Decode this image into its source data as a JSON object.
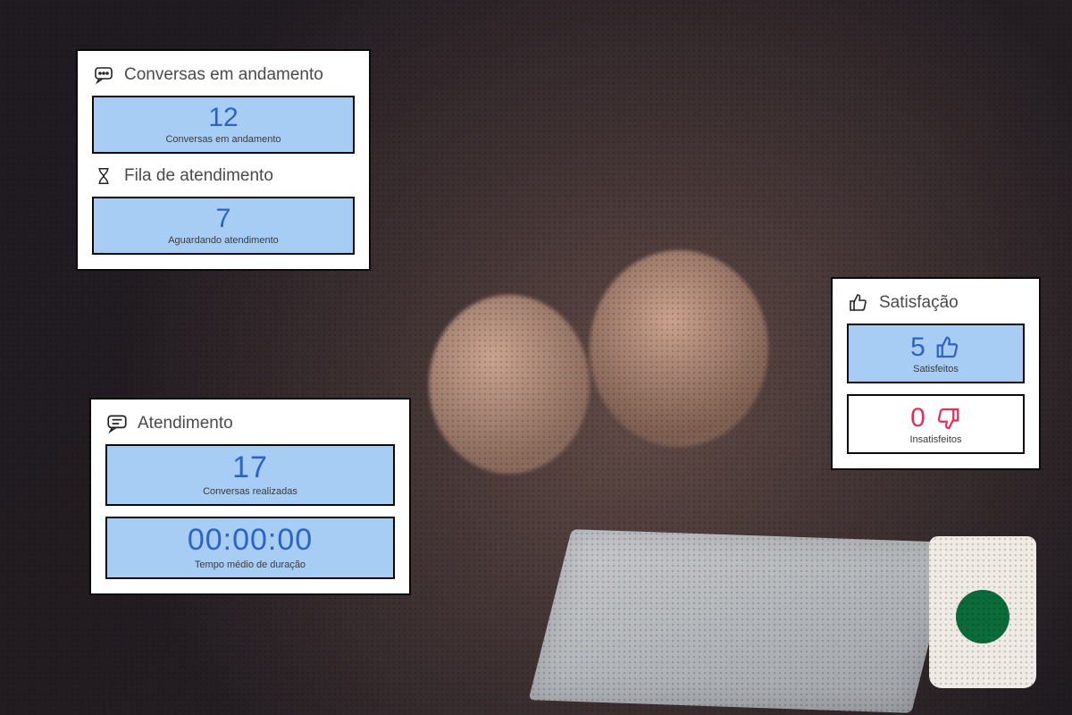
{
  "colors": {
    "accent_blue": "#2b64c4",
    "accent_red": "#e0315a",
    "panel_blue": "#a8cdf4"
  },
  "cards": {
    "conversas": {
      "title": "Conversas em andamento",
      "metric1": {
        "value": "12",
        "label": "Conversas em andamento"
      },
      "title2": "Fila de atendimento",
      "metric2": {
        "value": "7",
        "label": "Aguardando atendimento"
      }
    },
    "atendimento": {
      "title": "Atendimento",
      "metric1": {
        "value": "17",
        "label": "Conversas realizadas"
      },
      "metric2": {
        "value": "00:00:00",
        "label": "Tempo médio de duração"
      }
    },
    "satisfacao": {
      "title": "Satisfação",
      "metric1": {
        "value": "5",
        "label": "Satisfeitos"
      },
      "metric2": {
        "value": "0",
        "label": "Insatisfeitos"
      }
    }
  }
}
